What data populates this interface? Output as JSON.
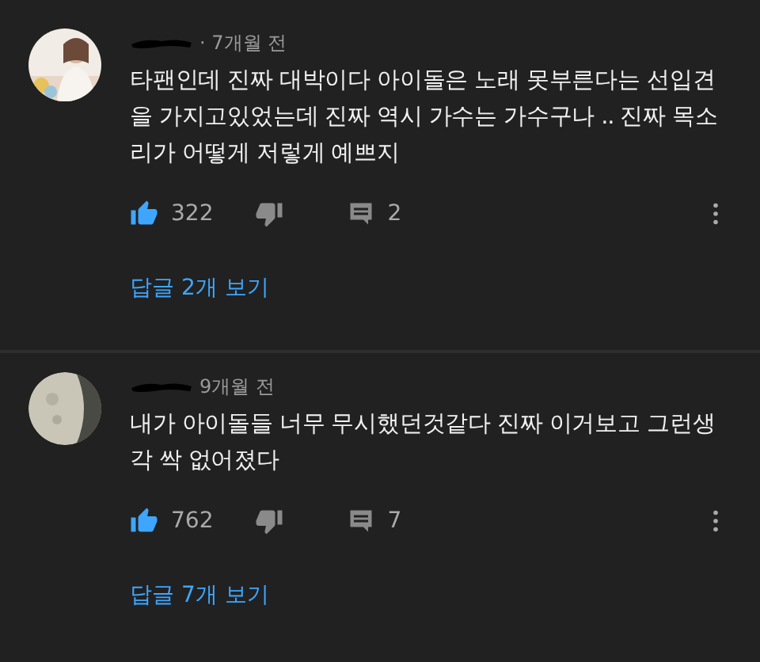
{
  "comments": [
    {
      "author_hidden": true,
      "time": "· 7개월 전",
      "body": "타팬인데 진짜 대박이다 아이돌은 노래 못부른다는 선입견을 가지고있었는데 진짜 역시 가수는 가수구나 .. 진짜 목소리가 어떻게 저렇게 예쁘지",
      "liked": true,
      "likes": "322",
      "replies_count": "2",
      "replies_link": "답글 2개 보기"
    },
    {
      "author_hidden": true,
      "time": "9개월 전",
      "body": "내가 아이돌들 너무 무시했던것같다 진짜 이거보고 그런생각 싹 없어졌다",
      "liked": true,
      "likes": "762",
      "replies_count": "7",
      "replies_link": "답글 7개 보기"
    }
  ]
}
